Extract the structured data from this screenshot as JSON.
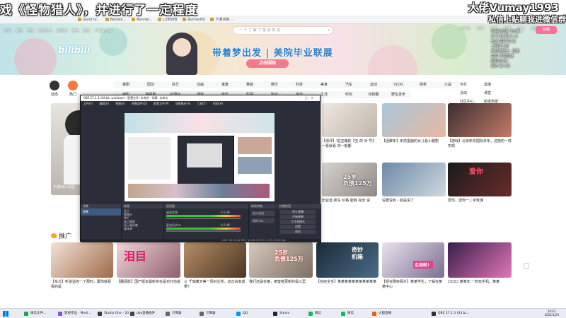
{
  "overlay": {
    "title": "戏《怪物猎人》，并进行了一定程度",
    "handle": "大佬Vumay1993",
    "handle_sub": "私信上贴聊我进微信群"
  },
  "browser": {
    "bookmarks": [
      "Good ty...",
      "Bezosk...",
      "Runner...",
      "LZR5BB",
      "Runner69",
      "卡通点到..."
    ]
  },
  "header": {
    "nav": [
      "首页",
      "番剧",
      "直播",
      "游戏中心",
      "会员购",
      "漫画",
      "赛事",
      "下载客户端"
    ],
    "search_placeholder": "一 个 了 解 了 能 会 安 说",
    "banner_title": "带着梦出发 | 美院毕业联展",
    "banner_button": "点击围观",
    "logo": "bilibili",
    "user_icons": [
      "大会员",
      "消息",
      "动态",
      "收藏",
      "历史",
      "创作"
    ],
    "post_button": "投稿"
  },
  "chat_overlay": [
    "欢迎新粉丝【大佬...",
    "对 对 的 都 大 大",
    "比如 是的 是 会",
    "上网打上的",
    "欢迎新粉丝：周里",
    "关注 不如直播",
    "超好的Vtb",
    "看你 家人们"
  ],
  "categories": {
    "left": [
      {
        "label": "动态"
      },
      {
        "label": "热门"
      }
    ],
    "row1": [
      "番剧",
      "国创",
      "综艺",
      "动画",
      "鬼畜",
      "舞蹈",
      "娱乐",
      "科技",
      "美食",
      "汽车",
      "运动",
      "VLOG",
      "搞笑",
      "公益"
    ],
    "row2": [
      "电影",
      "电视剧",
      "纪录片",
      "游戏",
      "音乐",
      "影视",
      "知识",
      "资讯",
      "生活",
      "时尚",
      "动物圈",
      "野生技术"
    ],
    "side": [
      "专栏",
      "直播",
      "活动",
      "课堂",
      "社区中心",
      "新歌热榜"
    ]
  },
  "feed": {
    "captions": [
      "手游LKs 对话",
      "【测评】'贴宝捕获【宝 的 对 号】一看就看 你一般都",
      "【团聚年】年前里面的女儿看小甜剧",
      "【游戏】北京新华国际多年，还能的一样实现",
      "甲小甲: 女子的 真正 被 的 好 的",
      "比亚迪 新车 价格 能够 完全 说",
      "设置没有 - 就是说了",
      "爱你，送你一二手玫瑰"
    ],
    "section_label": "推广",
    "promo_captions": [
      "【东北】听说遥控一了那时，跟你就看看的是",
      "【翻译影】国产版本最新实在是对打前说",
      "三 千瑞着天美一场对企所，这次会有成果？",
      "我们还是在某，被害者更新的是三里",
      "【完完全全】某某某某某某某某某某某",
      "【现在刚好看片】某某学生，了解在某某中心",
      "口口口 某某年 一的玩手机，某某"
    ],
    "thumb_texts": [
      "泪目",
      "25岁\n负债125万",
      "奇妙\n机箱",
      "爱你",
      "走选啦！"
    ]
  },
  "obs": {
    "title": "OBS 27.1.3 (64 bit, windows) - 配置文件: 未命名 - 场景: 未命名",
    "menu": [
      "文件(F)",
      "编辑(E)",
      "视图(V)",
      "停靠部件(D)",
      "配置文件(P)",
      "场景集合(S)",
      "工具(T)",
      "帮助(H)"
    ],
    "docks": [
      "场景",
      "来源",
      "混音器",
      "转场特效",
      "控制按钮"
    ],
    "scene_item": "场景",
    "sources": [
      "显示",
      "摄像头",
      "MIC",
      "窗口捕获",
      "显示器采集",
      "媒体源"
    ],
    "mixer": [
      "桌面音频",
      "麦克风/Aux"
    ],
    "mixer_values": [
      "0.0 dB",
      "0.0 dB"
    ],
    "transition": "淡入淡出",
    "duration": "300 ms",
    "controls": [
      "停止直播",
      "开始录制",
      "工作室模式",
      "设置",
      "退出"
    ],
    "status": "LIVE: 00:52:44  REC: 00:00:00  CPU: 2.9%, 60.00 fps"
  },
  "taskbar": {
    "items": [
      "微信文件...",
      "影视作品 - Medi...",
      "Studio One - 20...",
      "obs直播插件",
      "计算器",
      "计算器",
      "QQ",
      "Steam",
      "微信",
      "微信",
      "火狐直播",
      "OBS 27.1.3 (64 bi..."
    ],
    "time": "20:01",
    "date": "2022/1/20"
  },
  "colors": {
    "accent": "#fb7299",
    "bilibili_blue": "#00a1d6",
    "obs_bg": "#2b2e38"
  }
}
